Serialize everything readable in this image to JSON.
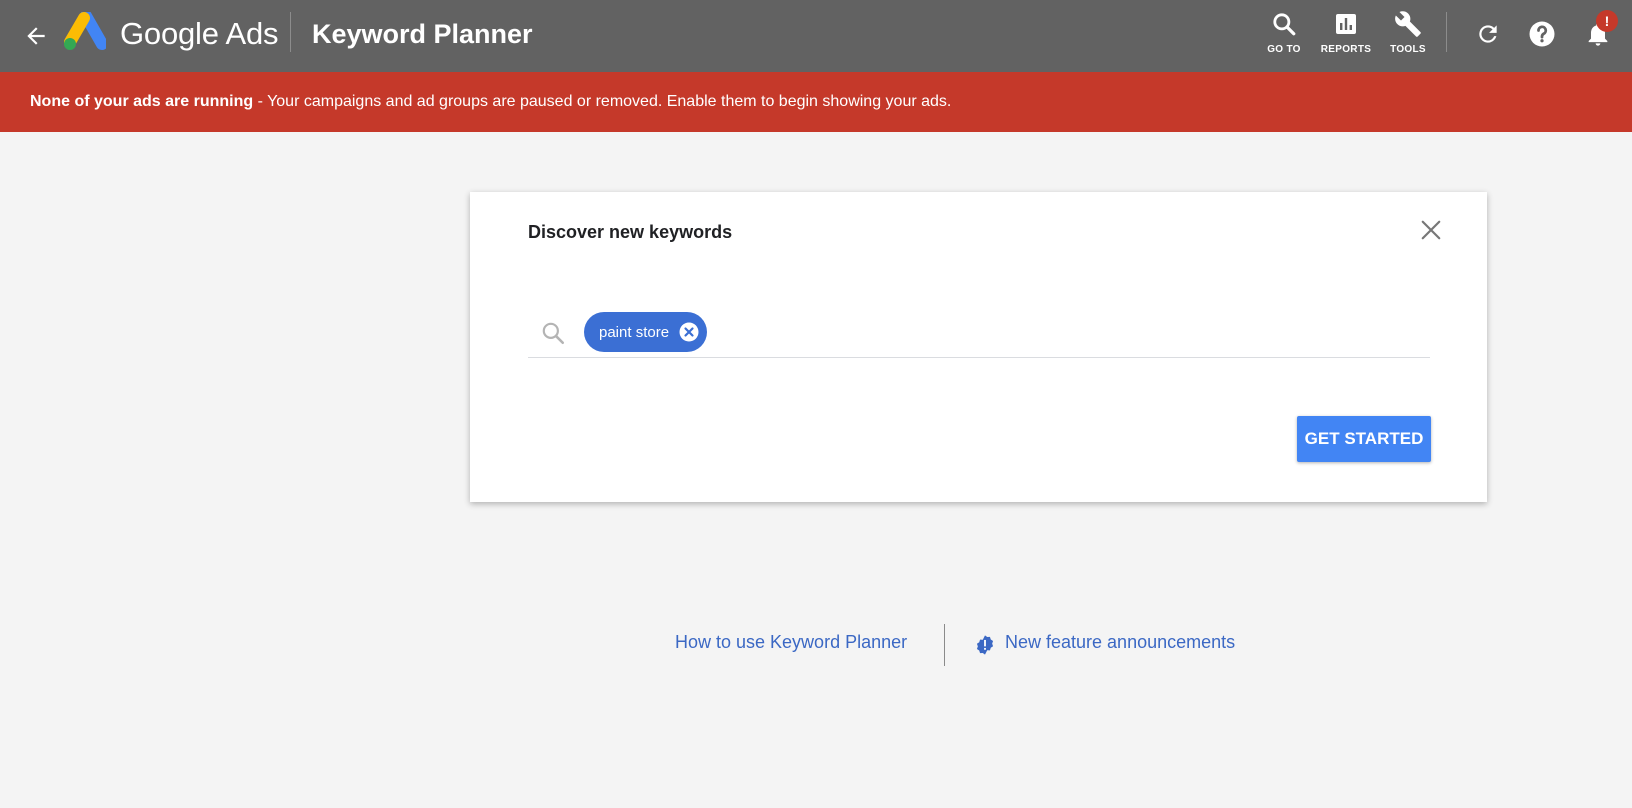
{
  "header": {
    "brand": "Google Ads",
    "title": "Keyword Planner",
    "tools": [
      {
        "label": "GO TO",
        "icon": "search-icon"
      },
      {
        "label": "REPORTS",
        "icon": "reports-icon"
      },
      {
        "label": "TOOLS",
        "icon": "wrench-icon"
      }
    ],
    "notification_badge": "!"
  },
  "alert": {
    "bold_text": "None of your ads are running",
    "text": " - Your campaigns and ad groups are paused or removed. Enable them to begin showing your ads.",
    "color": "#c5392a"
  },
  "card": {
    "title": "Discover new keywords",
    "chip_label": "paint store",
    "search_placeholder": "",
    "get_started_label": "GET STARTED"
  },
  "links": {
    "how_to": "How to use Keyword Planner",
    "announcements": "New feature announcements"
  },
  "colors": {
    "header_bg": "#626262",
    "accent": "#4285f4",
    "chip": "#3b6fd4",
    "link": "#3b68c4",
    "page_bg": "#f4f4f4"
  }
}
